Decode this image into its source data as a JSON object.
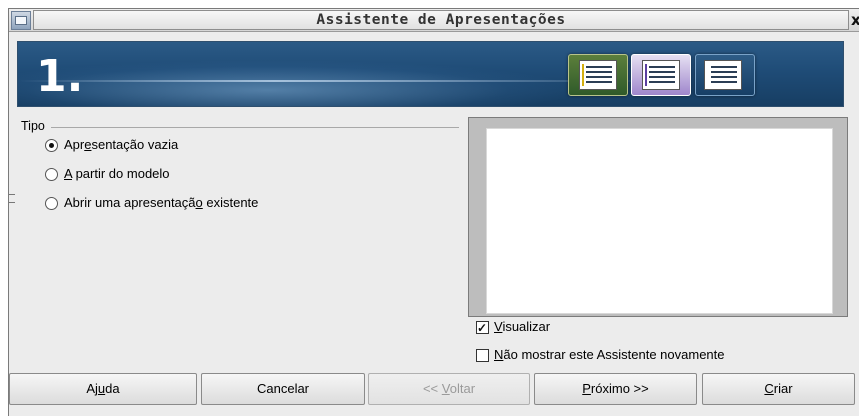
{
  "window": {
    "title": "Assistente de Apresentações",
    "close_glyph": "x",
    "app_icon": "presentation-app-icon"
  },
  "banner": {
    "step": "1.",
    "icons": [
      "slide-list-green-icon",
      "slide-list-purple-icon",
      "slide-list-blue-icon"
    ]
  },
  "tipo": {
    "label": "Tipo",
    "options": [
      {
        "pre": "Apr",
        "ul": "e",
        "post": "sentação vazia",
        "checked": true
      },
      {
        "pre": "",
        "ul": "A",
        "post": " partir do modelo",
        "checked": false
      },
      {
        "pre": "Abrir uma apresentaçã",
        "ul": "o",
        "post": " existente",
        "checked": false
      }
    ]
  },
  "preview": {
    "visualizar": {
      "pre": "",
      "ul": "V",
      "post": "isualizar",
      "checked": true
    },
    "nao_mostrar": {
      "pre": "",
      "ul": "N",
      "post": "ão mostrar este Assistente novamente",
      "checked": false
    }
  },
  "buttons": {
    "ajuda": {
      "pre": "Aj",
      "ul": "u",
      "post": "da"
    },
    "cancelar": {
      "pre": "Cancelar",
      "ul": "",
      "post": ""
    },
    "voltar": {
      "pre": "<< ",
      "ul": "V",
      "post": "oltar"
    },
    "proximo": {
      "pre": "",
      "ul": "P",
      "post": "róximo >>"
    },
    "criar": {
      "pre": "",
      "ul": "C",
      "post": "riar"
    }
  }
}
